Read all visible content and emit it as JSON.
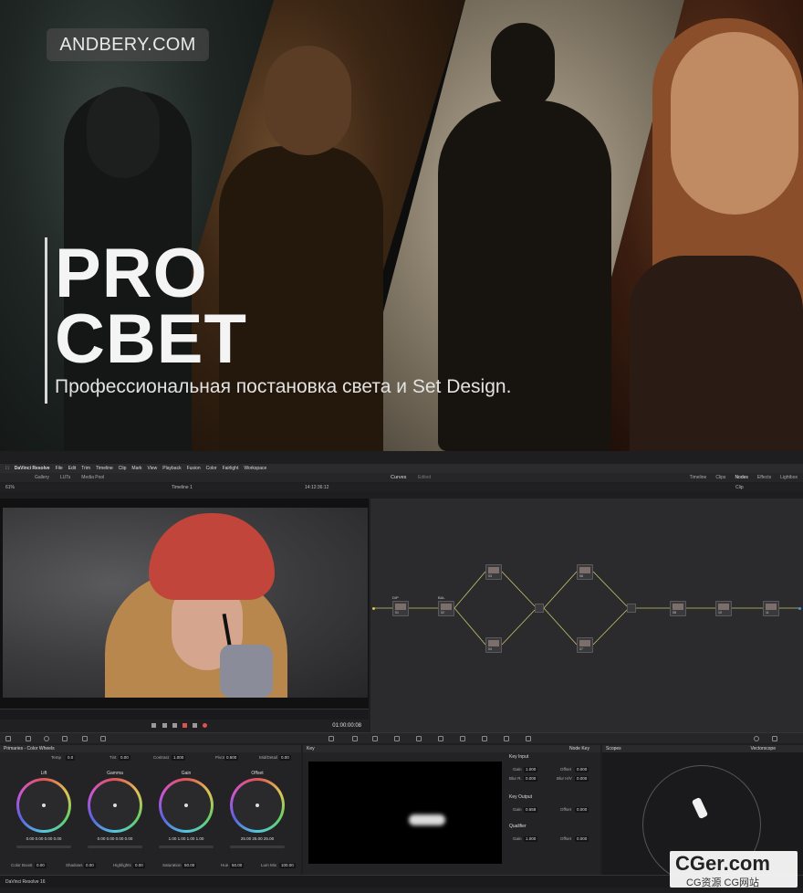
{
  "banner": {
    "badge": "ANDBERY.COM",
    "title_line1": "PRO",
    "title_line2": "СВЕТ",
    "subtitle": "Профессиональная постановка света и Set Design."
  },
  "resolve": {
    "menu": [
      "DaVinci Resolve",
      "File",
      "Edit",
      "Trim",
      "Timeline",
      "Clip",
      "Mark",
      "View",
      "Playback",
      "Fusion",
      "Color",
      "Fairlight",
      "Workspace"
    ],
    "topbar": {
      "left": [
        "Gallery",
        "LUTs",
        "Media Pool"
      ],
      "center": "Curves",
      "center_sub": "Edited",
      "right": [
        "Timeline",
        "Clips",
        "Nodes",
        "Effects",
        "Lightbox"
      ]
    },
    "subbar": {
      "zoom": "61%",
      "timeline": "Timeline 1",
      "timecode": "14:12:36:12",
      "clip_label": "Clip"
    },
    "viewer": {
      "timecode": "01:00:00:08"
    },
    "nodes": [
      {
        "label": "DIP",
        "num": "01"
      },
      {
        "label": "BAL",
        "num": "02"
      },
      {
        "label": "",
        "num": "03"
      },
      {
        "label": "",
        "num": "04"
      },
      {
        "label": "",
        "num": "06"
      },
      {
        "label": "",
        "num": "07"
      },
      {
        "label": "",
        "num": "08"
      },
      {
        "label": "",
        "num": "10"
      },
      {
        "label": "",
        "num": "11"
      }
    ],
    "primaries": {
      "title": "Primaries - Color Wheels",
      "params_top": [
        {
          "label": "Temp",
          "value": "0.0"
        },
        {
          "label": "Tint",
          "value": "0.00"
        },
        {
          "label": "Contrast",
          "value": "1.000"
        },
        {
          "label": "Pivot",
          "value": "0.500"
        },
        {
          "label": "Mid/Detail",
          "value": "0.00"
        }
      ],
      "wheels": [
        {
          "name": "Lift",
          "values": "0.00  0.00  0.00  0.00"
        },
        {
          "name": "Gamma",
          "values": "0.00  0.00  0.00  0.00"
        },
        {
          "name": "Gain",
          "values": "1.00  1.00  1.00  1.00"
        },
        {
          "name": "Offset",
          "values": "25.00  25.00  25.00"
        }
      ],
      "params_bottom": [
        {
          "label": "Color Boost",
          "value": "0.00"
        },
        {
          "label": "Shadows",
          "value": "0.00"
        },
        {
          "label": "Highlights",
          "value": "0.00"
        },
        {
          "label": "Saturation",
          "value": "50.00"
        },
        {
          "label": "Hue",
          "value": "50.00"
        },
        {
          "label": "Lum Mix",
          "value": "100.00"
        }
      ]
    },
    "key": {
      "title": "Key",
      "node_key": "Node Key",
      "key_input": "Key Input",
      "key_output": "Key Output",
      "qualifier": "Qualifier",
      "gain_label": "Gain",
      "offset_label": "Offset",
      "blurr_label": "Blur R.",
      "blurhv_label": "Blur H/V",
      "gain1": "1.000",
      "offset1": "0.000",
      "blurr": "0.000",
      "blurhv": "0.000",
      "gain2": "0.658",
      "offset2": "0.000",
      "gain3": "1.000",
      "offset3": "0.000"
    },
    "scopes": {
      "title": "Scopes",
      "mode": "Vectorscope"
    },
    "status": {
      "brand": "DaVinci Resolve 16"
    }
  },
  "watermark": {
    "main": "CGer.com",
    "sub": "CG资源 CG网站"
  }
}
